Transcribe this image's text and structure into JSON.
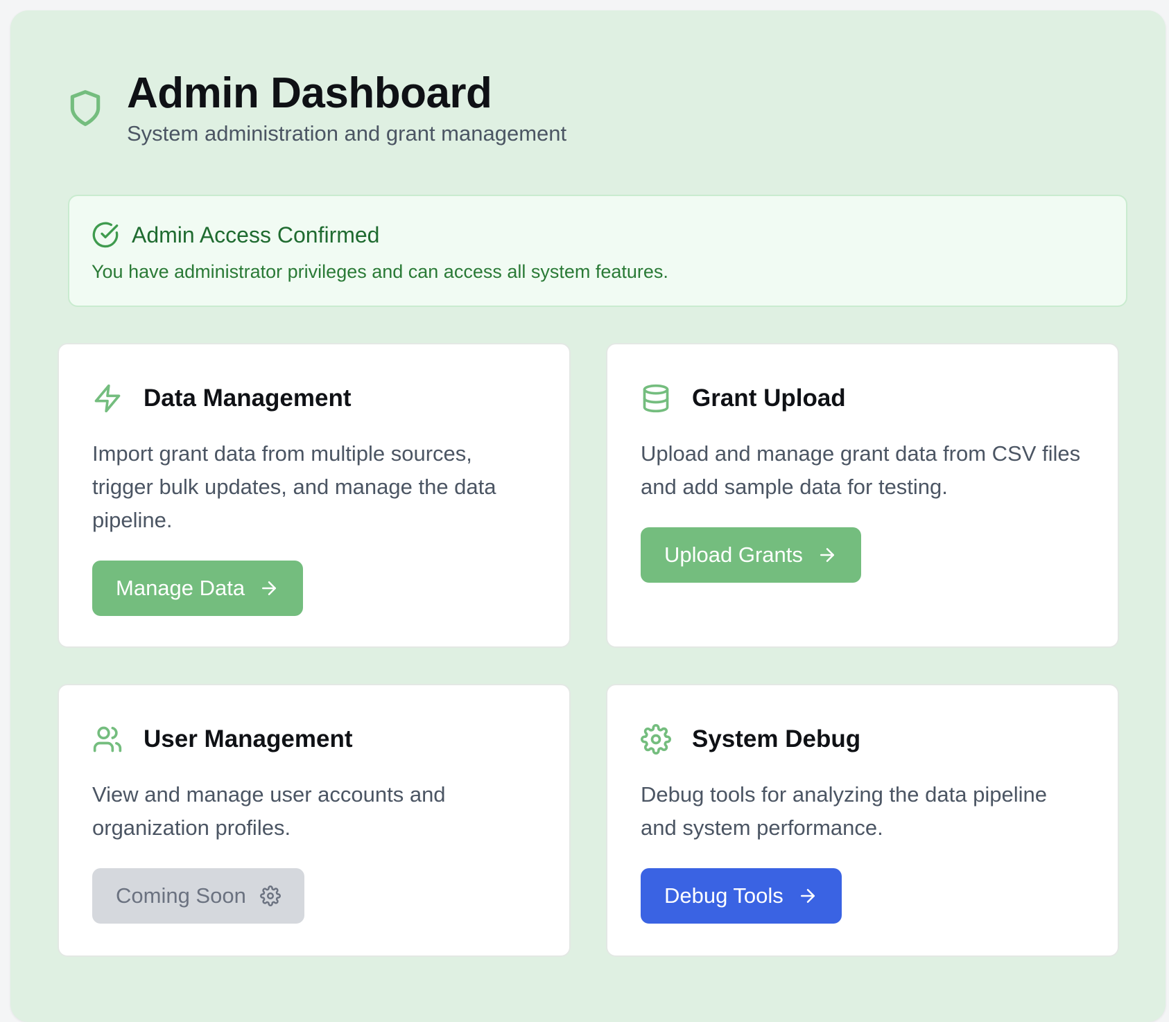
{
  "header": {
    "title": "Admin Dashboard",
    "subtitle": "System administration and grant management",
    "icon": "shield-icon"
  },
  "alert": {
    "title": "Admin Access Confirmed",
    "text": "You have administrator privileges and can access all system features.",
    "icon": "check-circle-icon"
  },
  "cards": [
    {
      "title": "Data Management",
      "icon": "lightning-icon",
      "description": "Import grant data from multiple sources, trigger bulk updates, and manage the data pipeline.",
      "button_label": "Manage Data",
      "button_icon": "arrow-right-icon"
    },
    {
      "title": "Grant Upload",
      "icon": "database-icon",
      "description": "Upload and manage grant data from CSV files and add sample data for testing.",
      "button_label": "Upload Grants",
      "button_icon": "arrow-right-icon"
    },
    {
      "title": "User Management",
      "icon": "users-icon",
      "description": "View and manage user accounts and organization profiles.",
      "button_label": "Coming Soon",
      "button_icon": "gear-icon"
    },
    {
      "title": "System Debug",
      "icon": "gear-icon",
      "description": "Debug tools for analyzing the data pipeline and system performance.",
      "button_label": "Debug Tools",
      "button_icon": "arrow-right-icon"
    }
  ],
  "colors": {
    "page_background": "#dff0e2",
    "accent_green": "#74bd7e",
    "alert_text": "#1f6b30",
    "debug_blue": "#3a63e3",
    "disabled_gray": "#d5d8dd"
  }
}
